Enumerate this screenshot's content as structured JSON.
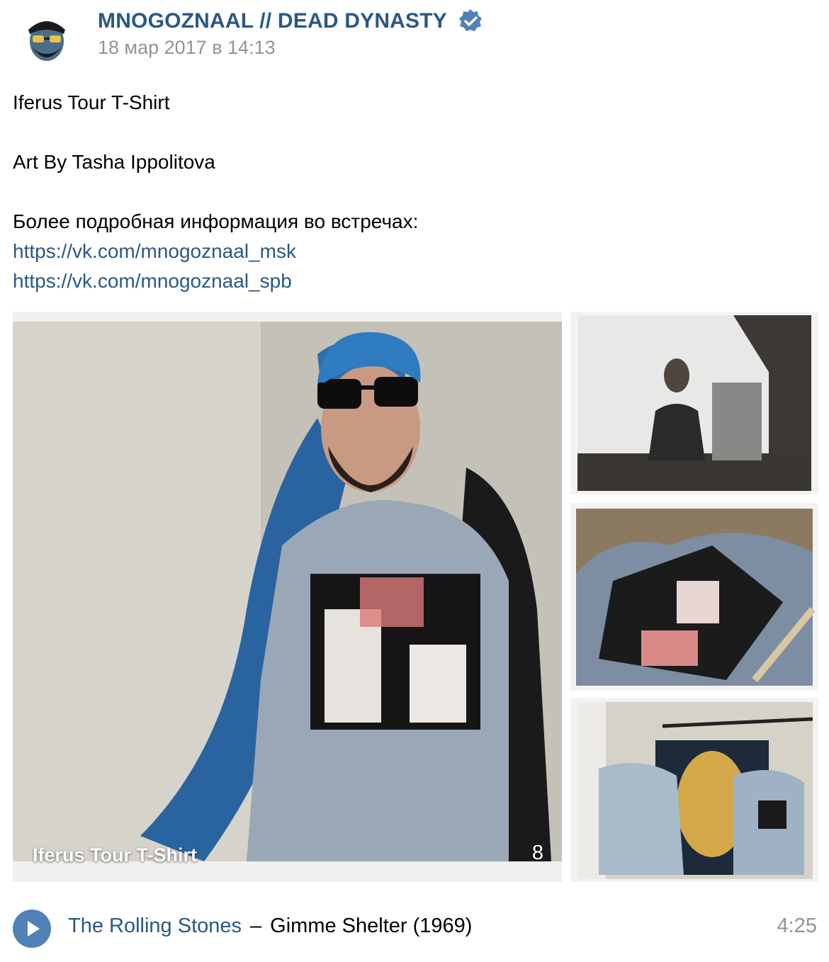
{
  "post": {
    "author_name": "MNOGOZNAAL // DEAD DYNASTY",
    "verified": true,
    "date": "18 мар 2017 в 14:13",
    "text": {
      "line1": "Iferus Tour T-Shirt",
      "line2": "Art By Tasha Ippolitova",
      "line3": "Более подробная информация во встречах:",
      "link1": "https://vk.com/mnogoznaal_msk",
      "link2": "https://vk.com/mnogoznaal_spb"
    }
  },
  "photos": {
    "caption": "Iferus Tour T-Shirt",
    "count": "8"
  },
  "audio": {
    "artist": "The Rolling Stones",
    "separator": "–",
    "title": "Gimme Shelter (1969)",
    "duration": "4:25"
  },
  "colors": {
    "link": "#2a5885",
    "muted": "#939393",
    "play_button": "#5181b8",
    "verified_badge": "#5181b8"
  },
  "icons": {
    "verified": "verified-check-icon",
    "play": "play-icon"
  }
}
